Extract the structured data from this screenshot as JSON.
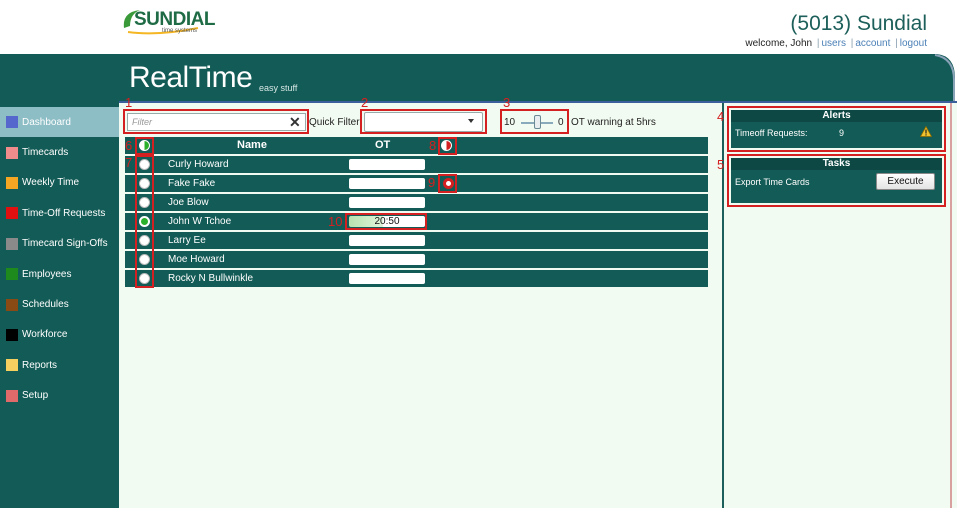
{
  "header": {
    "logo_text": "SUNDIAL",
    "logo_sub": "time systems",
    "company": "(5013) Sundial",
    "welcome": "welcome, John",
    "links": [
      "users",
      "account",
      "logout"
    ]
  },
  "banner": {
    "title": "RealTime",
    "subtitle": "easy stuff"
  },
  "sidebar": {
    "items": [
      {
        "label": "Dashboard",
        "color": "#5566cc",
        "active": true
      },
      {
        "label": "Timecards",
        "color": "#f08c8c"
      },
      {
        "label": "Weekly Time",
        "color": "#f5a623"
      },
      {
        "label": "Time-Off Requests",
        "color": "#e01010"
      },
      {
        "label": "Timecard Sign-Offs",
        "color": "#8a8a8a"
      },
      {
        "label": "Employees",
        "color": "#1e8a1e"
      },
      {
        "label": "Schedules",
        "color": "#8a4a14"
      },
      {
        "label": "Workforce",
        "color": "#000000"
      },
      {
        "label": "Reports",
        "color": "#f5d060"
      },
      {
        "label": "Setup",
        "color": "#e06a6a"
      }
    ]
  },
  "filter": {
    "placeholder": "Filter",
    "quick_filter_label": "Quick Filter",
    "quick_filter_value": "",
    "slider_min": "10",
    "slider_max": "0",
    "ot_warning": "OT warning at 5hrs"
  },
  "table": {
    "headers": {
      "name": "Name",
      "ot": "OT"
    },
    "rows": [
      {
        "name": "Curly Howard",
        "ot": "",
        "selected": false
      },
      {
        "name": "Fake Fake",
        "ot": "",
        "selected": false
      },
      {
        "name": "Joe Blow",
        "ot": "",
        "selected": false
      },
      {
        "name": "John W Tchoe",
        "ot": "20:50",
        "selected": true
      },
      {
        "name": "Larry Ee",
        "ot": "",
        "selected": false
      },
      {
        "name": "Moe Howard",
        "ot": "",
        "selected": false
      },
      {
        "name": "Rocky N Bullwinkle",
        "ot": "",
        "selected": false
      }
    ]
  },
  "alerts": {
    "title": "Alerts",
    "timeoff_label": "Timeoff Requests:",
    "timeoff_count": "9"
  },
  "tasks": {
    "title": "Tasks",
    "export_label": "Export Time Cards",
    "execute_label": "Execute"
  },
  "annotations": [
    "1",
    "2",
    "3",
    "4",
    "5",
    "6",
    "7",
    "8",
    "9",
    "10"
  ]
}
